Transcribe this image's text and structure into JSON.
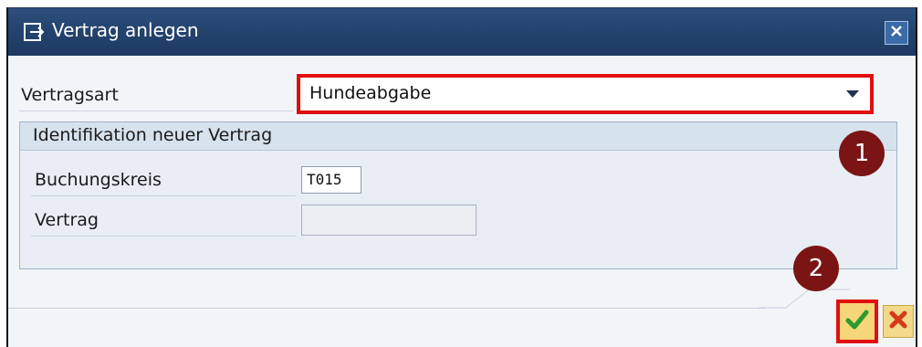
{
  "dialog": {
    "title": "Vertrag anlegen",
    "title_icon": "create-document-icon",
    "close_icon": "close-icon"
  },
  "form": {
    "vertragsart": {
      "label": "Vertragsart",
      "value": "Hundeabgabe"
    },
    "group": {
      "title": "Identifikation neuer Vertrag",
      "buchungskreis": {
        "label": "Buchungskreis",
        "value": "T015"
      },
      "vertrag": {
        "label": "Vertrag",
        "value": ""
      }
    }
  },
  "annotations": {
    "badge1": "1",
    "badge2": "2"
  },
  "buttons": {
    "confirm_icon": "checkmark-icon",
    "cancel_icon": "cancel-x-icon"
  },
  "colors": {
    "titlebar": "#23426d",
    "highlight": "#e01010",
    "badge": "#7b1515"
  }
}
